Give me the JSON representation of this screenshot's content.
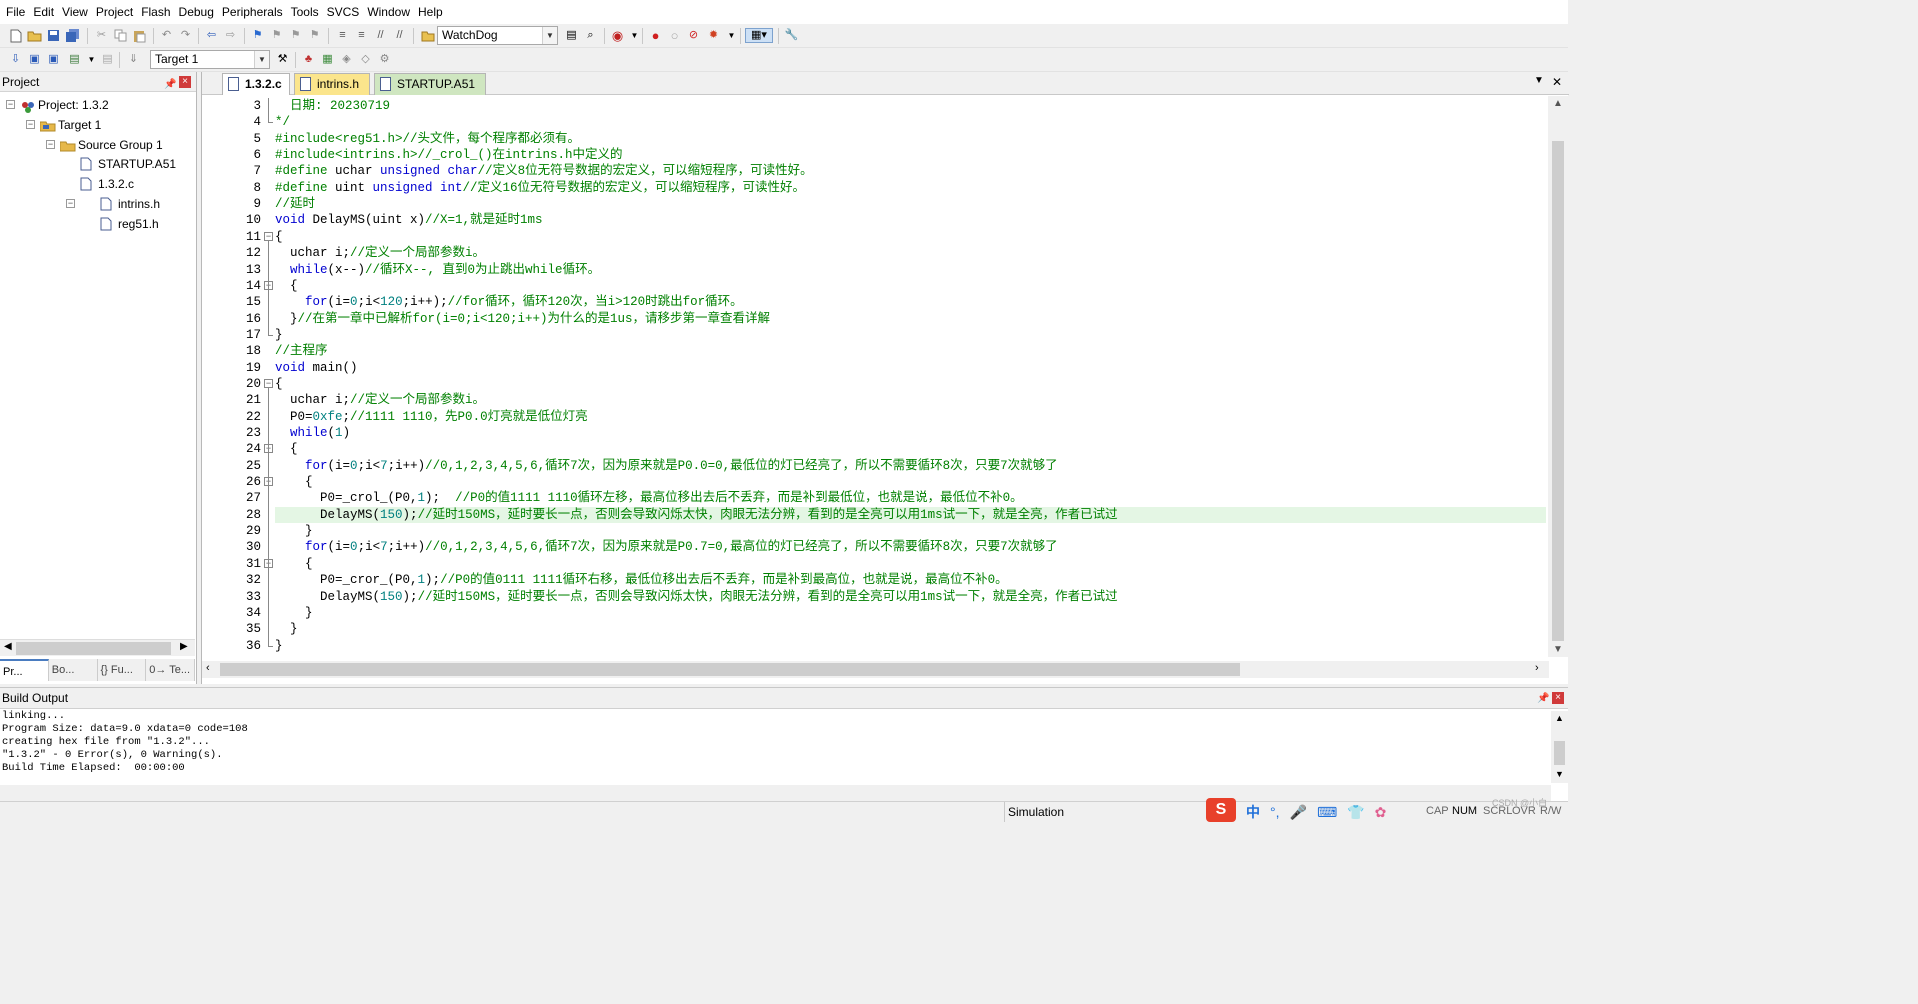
{
  "menu": [
    "File",
    "Edit",
    "View",
    "Project",
    "Flash",
    "Debug",
    "Peripherals",
    "Tools",
    "SVCS",
    "Window",
    "Help"
  ],
  "toolbar": {
    "target_combo": "WatchDog",
    "build_target": "Target 1"
  },
  "project_panel": {
    "title": "Project",
    "tree": {
      "project": "Project: 1.3.2",
      "target": "Target 1",
      "group": "Source Group 1",
      "files": [
        "STARTUP.A51",
        "1.3.2.c",
        "intrins.h",
        "reg51.h"
      ]
    },
    "tabs": [
      "Pr...",
      "Bo...",
      "{} Fu...",
      "0→ Te..."
    ]
  },
  "editor": {
    "tabs": [
      "1.3.2.c",
      "intrins.h",
      "STARTUP.A51"
    ],
    "line_numbers": [
      "3",
      "4",
      "5",
      "6",
      "7",
      "8",
      "9",
      "10",
      "11",
      "12",
      "13",
      "14",
      "15",
      "16",
      "17",
      "18",
      "19",
      "20",
      "21",
      "22",
      "23",
      "24",
      "25",
      "26",
      "27",
      "28",
      "29",
      "30",
      "31",
      "32",
      "33",
      "34",
      "35",
      "36"
    ]
  },
  "build": {
    "title": "Build Output",
    "lines": [
      "linking...",
      "Program Size: data=9.0 xdata=0 code=108",
      "creating hex file from \"1.3.2\"...",
      "\"1.3.2\" - 0 Error(s), 0 Warning(s).",
      "Build Time Elapsed:  00:00:00"
    ]
  },
  "status": {
    "mode": "Simulation",
    "ime_lang": "中",
    "indicators": [
      "CAP",
      "NUM",
      "SCRL",
      "OVR",
      "R/W"
    ],
    "watermark": "CSDN @小白"
  }
}
